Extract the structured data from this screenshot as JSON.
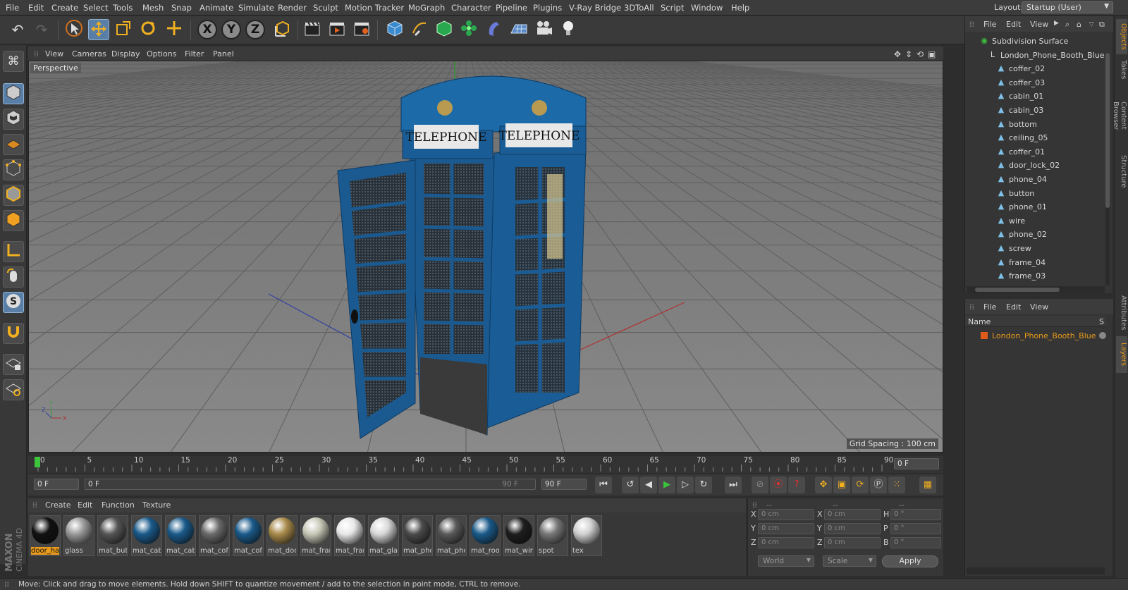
{
  "menubar": {
    "items": [
      "File",
      "Edit",
      "Create",
      "Select",
      "Tools",
      "Mesh",
      "Snap",
      "Animate",
      "Simulate",
      "Render",
      "Sculpt",
      "Motion Tracker",
      "MoGraph",
      "Character",
      "Pipeline",
      "Plugins",
      "V-Ray Bridge",
      "3DToAll",
      "Script",
      "Window",
      "Help"
    ],
    "layout_label": "Layout:",
    "layout_value": "Startup (User)"
  },
  "toolbar": {
    "axis_x": "X",
    "axis_y": "Y",
    "axis_z": "Z"
  },
  "viewport": {
    "menu": [
      "View",
      "Cameras",
      "Display",
      "Options",
      "Filter",
      "Panel"
    ],
    "label": "Perspective",
    "grid_spacing": "Grid Spacing : 100 cm",
    "sign_text": "TELEPHONE",
    "axis_x": "X",
    "axis_y": "Y",
    "axis_z": "Z"
  },
  "timeline": {
    "ticks": [
      "0",
      "5",
      "10",
      "15",
      "20",
      "25",
      "30",
      "35",
      "40",
      "45",
      "50",
      "55",
      "60",
      "65",
      "70",
      "75",
      "80",
      "85",
      "90"
    ],
    "current_frame": "0 F"
  },
  "transport": {
    "start_field": "0 F",
    "range_start": "0 F",
    "range_end": "90 F",
    "end_field": "90 F"
  },
  "materials": {
    "menu": [
      "Create",
      "Edit",
      "Function",
      "Texture"
    ],
    "items": [
      {
        "label": "door_ha",
        "color": "#111111"
      },
      {
        "label": "glass",
        "color": "#9a9a9a"
      },
      {
        "label": "mat_but",
        "color": "#555555"
      },
      {
        "label": "mat_cab",
        "color": "#1a5a8a"
      },
      {
        "label": "mat_cab",
        "color": "#1a5a8a"
      },
      {
        "label": "mat_cof",
        "color": "#6a6a6a"
      },
      {
        "label": "mat_cof",
        "color": "#1a5a8a"
      },
      {
        "label": "mat_doo",
        "color": "#a88a4a"
      },
      {
        "label": "mat_fran",
        "color": "#c8c8b8"
      },
      {
        "label": "mat_fran",
        "color": "#e8e8e8"
      },
      {
        "label": "mat_gla",
        "color": "#d8d8d8"
      },
      {
        "label": "mat_pho",
        "color": "#4a4a4a"
      },
      {
        "label": "mat_pho",
        "color": "#5a5a5a"
      },
      {
        "label": "mat_roo",
        "color": "#1a5a8a"
      },
      {
        "label": "mat_wir",
        "color": "#1e1e1e"
      },
      {
        "label": "spot",
        "color": "#777777"
      },
      {
        "label": "tex",
        "color": "#d0d0d0"
      }
    ],
    "selected_index": 0
  },
  "coordinates": {
    "header_a": "--",
    "header_b": "--",
    "header_c": "--",
    "rows": [
      {
        "a_label": "X",
        "a_val": "0 cm",
        "b_label": "X",
        "b_val": "0 cm",
        "c_label": "H",
        "c_val": "0 °"
      },
      {
        "a_label": "Y",
        "a_val": "0 cm",
        "b_label": "Y",
        "b_val": "0 cm",
        "c_label": "P",
        "c_val": "0 °"
      },
      {
        "a_label": "Z",
        "a_val": "0 cm",
        "b_label": "Z",
        "b_val": "0 cm",
        "c_label": "B",
        "c_val": "0 °"
      }
    ],
    "mode_dropdown": "World",
    "scale_dropdown": "Scale",
    "apply": "Apply"
  },
  "objects": {
    "menu": [
      "File",
      "Edit",
      "View"
    ],
    "items": [
      {
        "name": "Subdivision Surface",
        "level": 0
      },
      {
        "name": "London_Phone_Booth_Blue",
        "level": 1
      },
      {
        "name": "coffer_02",
        "level": 2
      },
      {
        "name": "coffer_03",
        "level": 2
      },
      {
        "name": "cabin_01",
        "level": 2
      },
      {
        "name": "cabin_03",
        "level": 2
      },
      {
        "name": "bottom",
        "level": 2
      },
      {
        "name": "ceiling_05",
        "level": 2
      },
      {
        "name": "coffer_01",
        "level": 2
      },
      {
        "name": "door_lock_02",
        "level": 2
      },
      {
        "name": "phone_04",
        "level": 2
      },
      {
        "name": "button",
        "level": 2
      },
      {
        "name": "phone_01",
        "level": 2
      },
      {
        "name": "wire",
        "level": 2
      },
      {
        "name": "phone_02",
        "level": 2
      },
      {
        "name": "screw",
        "level": 2
      },
      {
        "name": "frame_04",
        "level": 2
      },
      {
        "name": "frame_03",
        "level": 2
      }
    ]
  },
  "layers": {
    "menu": [
      "File",
      "Edit",
      "View"
    ],
    "col_name": "Name",
    "col_s": "S",
    "items": [
      {
        "name": "London_Phone_Booth_Blue",
        "color": "#e05a1a"
      }
    ]
  },
  "right_tabs": [
    "Objects",
    "Takes",
    "Content Browser",
    "Structure",
    "Attributes",
    "Layers"
  ],
  "status": "Move: Click and drag to move elements. Hold down SHIFT to quantize movement / add to the selection in point mode, CTRL to remove.",
  "brand": {
    "line1": "MAXON",
    "line2": "CINEMA 4D"
  },
  "colors": {
    "accent_orange": "#e79a1c",
    "selection_blue": "#5a7fa6",
    "booth_blue": "#1a5d96"
  }
}
